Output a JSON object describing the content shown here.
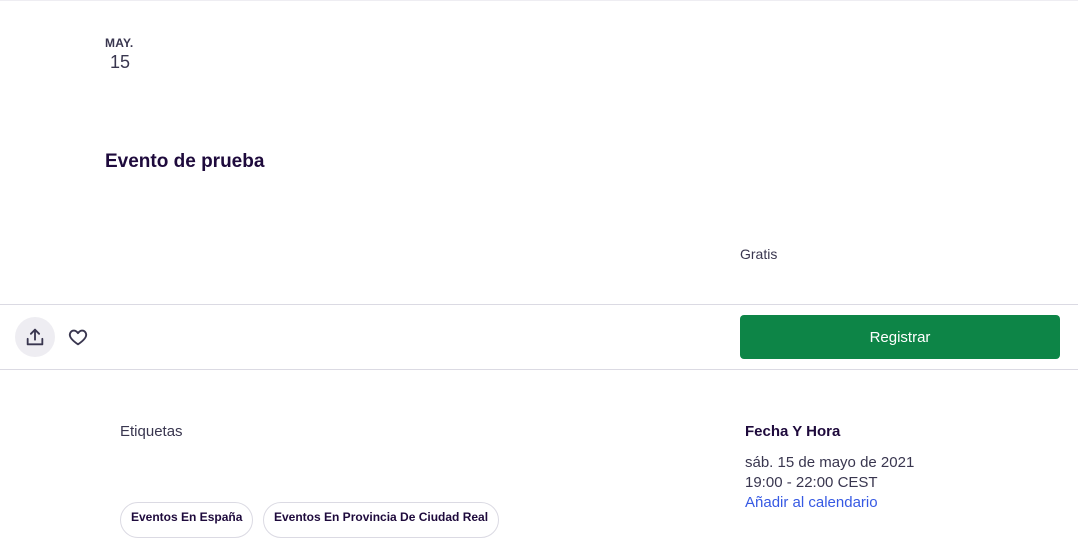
{
  "event": {
    "month": "MAY.",
    "day": "15",
    "title": "Evento de prueba",
    "price": "Gratis"
  },
  "actions": {
    "share_icon": "share-upload-icon",
    "like_icon": "heart-outline-icon",
    "register_label": "Registrar"
  },
  "tags": {
    "heading": "Etiquetas",
    "items": [
      "Eventos En España",
      "Eventos En Provincia De Ciudad Real"
    ]
  },
  "datetime": {
    "heading": "Fecha Y Hora",
    "date": "sáb. 15 de mayo de 2021",
    "time": "19:00 - 22:00 CEST",
    "add_to_calendar": "Añadir al calendario"
  },
  "colors": {
    "accent_green": "#0d8547",
    "link_blue": "#3659e3",
    "text_dark": "#1e0a3c"
  }
}
